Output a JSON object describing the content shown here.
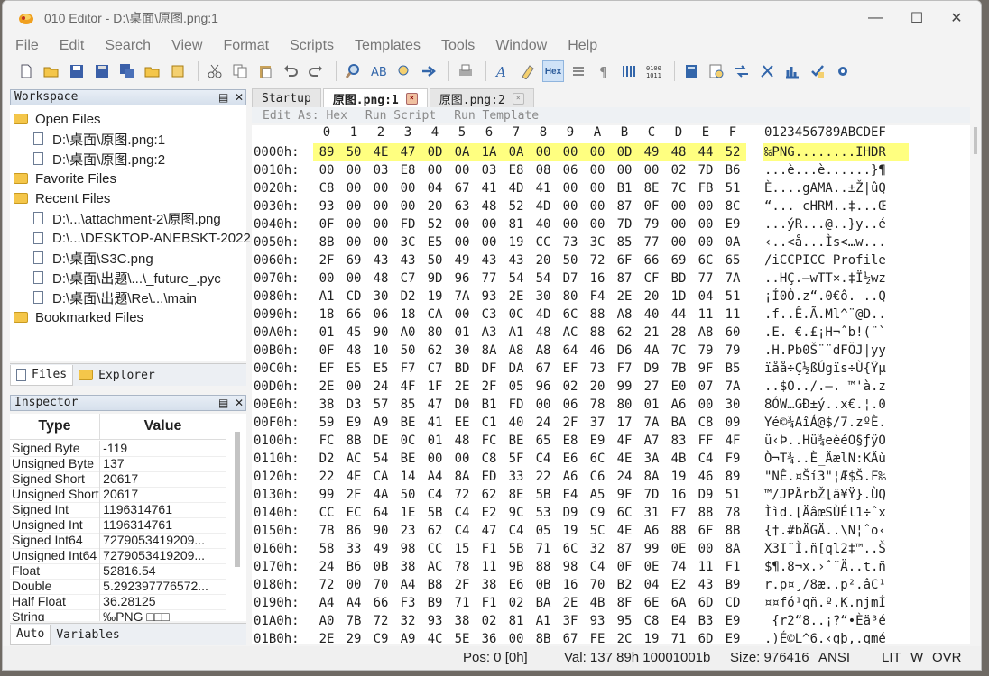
{
  "window": {
    "title": "010 Editor - D:\\桌面\\原图.png:1"
  },
  "menu": [
    "File",
    "Edit",
    "Search",
    "View",
    "Format",
    "Scripts",
    "Templates",
    "Tools",
    "Window",
    "Help"
  ],
  "toolbar_icons": [
    "new-file",
    "open-file",
    "save",
    "save-as",
    "save-all",
    "open-folder",
    "close",
    "cut",
    "copy",
    "paste",
    "undo",
    "redo",
    "find",
    "replace",
    "find-in-files",
    "goto",
    "print",
    "font",
    "highlight",
    "hex-mode",
    "bits",
    "paragraph",
    "columns",
    "binary",
    "calculator",
    "inspector",
    "compare",
    "tools",
    "histogram",
    "checksum",
    "options"
  ],
  "toolbar_hex_label": "Hex",
  "workspace": {
    "title": "Workspace",
    "open_files_label": "Open Files",
    "open_files": [
      "D:\\桌面\\原图.png:1",
      "D:\\桌面\\原图.png:2"
    ],
    "favorite_label": "Favorite Files",
    "recent_label": "Recent Files",
    "recent_files": [
      "D:\\...\\attachment-2\\原图.png",
      "D:\\...\\DESKTOP-ANEBSKT-2022",
      "D:\\桌面\\S3C.png",
      "D:\\桌面\\出题\\...\\_future_.pyc",
      "D:\\桌面\\出题\\Re\\...\\main"
    ],
    "bookmarked_label": "Bookmarked Files",
    "tabs": [
      "Files",
      "Explorer"
    ]
  },
  "inspector": {
    "title": "Inspector",
    "col_type": "Type",
    "col_value": "Value",
    "rows": [
      {
        "type": "Signed Byte",
        "value": "-119"
      },
      {
        "type": "Unsigned Byte",
        "value": "137"
      },
      {
        "type": "Signed Short",
        "value": "20617"
      },
      {
        "type": "Unsigned Short",
        "value": "20617"
      },
      {
        "type": "Signed Int",
        "value": "1196314761"
      },
      {
        "type": "Unsigned Int",
        "value": "1196314761"
      },
      {
        "type": "Signed Int64",
        "value": "7279053419209..."
      },
      {
        "type": "Unsigned Int64",
        "value": "7279053419209..."
      },
      {
        "type": "Float",
        "value": "52816.54"
      },
      {
        "type": "Double",
        "value": "5.292397776572..."
      },
      {
        "type": "Half Float",
        "value": "36.28125"
      },
      {
        "type": "String",
        "value": "‰PNG □□□"
      }
    ],
    "tabs": [
      "Auto",
      "Variables"
    ]
  },
  "editor": {
    "tabs": [
      {
        "label": "Startup"
      },
      {
        "label": "原图.png:1",
        "active": true
      },
      {
        "label": "原图.png:2"
      }
    ],
    "toolbar": [
      "Edit As: Hex",
      "Run Script",
      "Run Template"
    ],
    "col_headers": [
      "0",
      "1",
      "2",
      "3",
      "4",
      "5",
      "6",
      "7",
      "8",
      "9",
      "A",
      "B",
      "C",
      "D",
      "E",
      "F"
    ],
    "ascii_header": "0123456789ABCDEF",
    "rows": [
      {
        "addr": "0000h:",
        "bytes": "89 50 4E 47 0D 0A 1A 0A 00 00 00 0D 49 48 44 52",
        "ascii": "‰PNG........IHDR"
      },
      {
        "addr": "0010h:",
        "bytes": "00 00 03 E8 00 00 03 E8 08 06 00 00 00 02 7D B6",
        "ascii": "...è...è......}¶"
      },
      {
        "addr": "0020h:",
        "bytes": "C8 00 00 00 04 67 41 4D 41 00 00 B1 8E 7C FB 51",
        "ascii": "È....gAMA..±Ž|ûQ"
      },
      {
        "addr": "0030h:",
        "bytes": "93 00 00 00 20 63 48 52 4D 00 00 87 0F 00 00 8C",
        "ascii": "“... cHRM..‡...Œ"
      },
      {
        "addr": "0040h:",
        "bytes": "0F 00 00 FD 52 00 00 81 40 00 00 7D 79 00 00 E9",
        "ascii": "...ýR...@..}y..é"
      },
      {
        "addr": "0050h:",
        "bytes": "8B 00 00 3C E5 00 00 19 CC 73 3C 85 77 00 00 0A",
        "ascii": "‹..<å...Ìs<…w..."
      },
      {
        "addr": "0060h:",
        "bytes": "2F 69 43 43 50 49 43 43 20 50 72 6F 66 69 6C 65",
        "ascii": "/iCCPICC Profile"
      },
      {
        "addr": "0070h:",
        "bytes": "00 00 48 C7 9D 96 77 54 54 D7 16 87 CF BD 77 7A",
        "ascii": "..HÇ.–wTT×.‡Ï½wz"
      },
      {
        "addr": "0080h:",
        "bytes": "A1 CD 30 D2 19 7A 93 2E 30 80 F4 2E 20 1D 04 51",
        "ascii": "¡Í0Ò.z“.0€ô. ..Q"
      },
      {
        "addr": "0090h:",
        "bytes": "18 66 06 18 CA 00 C3 0C 4D 6C 88 A8 40 44 11 11",
        "ascii": ".f..Ê.Ã.Ml^¨@D.."
      },
      {
        "addr": "00A0h:",
        "bytes": "01 45 90 A0 80 01 A3 A1 48 AC 88 62 21 28 A8 60",
        "ascii": ".E. €.£¡H¬ˆb!(¨`"
      },
      {
        "addr": "00B0h:",
        "bytes": "0F 48 10 50 62 30 8A A8 A8 64 46 D6 4A 7C 79 79",
        "ascii": ".H.Pb0Š¨¨dFÖJ|yy"
      },
      {
        "addr": "00C0h:",
        "bytes": "EF E5 E5 F7 C7 BD DF DA 67 EF 73 F7 D9 7B 9F B5",
        "ascii": "ïåå÷Ç½ßÚgïs÷Ù{Ÿµ"
      },
      {
        "addr": "00D0h:",
        "bytes": "2E 00 24 4F 1F 2E 2F 05 96 02 20 99 27 E0 07 7A",
        "ascii": "..$O../.–. ™'à.z"
      },
      {
        "addr": "00E0h:",
        "bytes": "38 D3 57 85 47 D0 B1 FD 00 06 78 80 01 A6 00 30",
        "ascii": "8ÓW…GÐ±ý..x€.¦.0"
      },
      {
        "addr": "00F0h:",
        "bytes": "59 E9 A9 BE 41 EE C1 40 24 2F 37 17 7A BA C8 09",
        "ascii": "Yé©¾AîÁ@$/7.zºÈ."
      },
      {
        "addr": "0100h:",
        "bytes": "FC 8B DE 0C 01 48 FC BE 65 E8 E9 4F A7 83 FF 4F",
        "ascii": "ü‹Þ..Hü¾eèéO§ƒÿO"
      },
      {
        "addr": "0110h:",
        "bytes": "D2 AC 54 BE 00 00 C8 5F C4 E6 6C 4E 3A 4B C4 F9",
        "ascii": "Ò¬T¾..È_ÄælN:KÄù"
      },
      {
        "addr": "0120h:",
        "bytes": "22 4E CA 14 A4 8A ED 33 22 A6 C6 24 8A 19 46 89",
        "ascii": "\"NÊ.¤Ší3\"¦Æ$Š.F‰"
      },
      {
        "addr": "0130h:",
        "bytes": "99 2F 4A 50 C4 72 62 8E 5B E4 A5 9F 7D 16 D9 51",
        "ascii": "™/JPÄrbŽ[ä¥Ÿ}.ÙQ"
      },
      {
        "addr": "0140h:",
        "bytes": "CC EC 64 1E 5B C4 E2 9C 53 D9 C9 6C 31 F7 88 78",
        "ascii": "Ììd.[ÄâœSÙÉl1÷ˆx"
      },
      {
        "addr": "0150h:",
        "bytes": "7B 86 90 23 62 C4 47 C4 05 19 5C 4E A6 88 6F 8B",
        "ascii": "{†.#bÄGÄ..\\N¦ˆo‹"
      },
      {
        "addr": "0160h:",
        "bytes": "58 33 49 98 CC 15 F1 5B 71 6C 32 87 99 0E 00 8A",
        "ascii": "X3I˜Ì.ñ[ql2‡™..Š"
      },
      {
        "addr": "0170h:",
        "bytes": "24 B6 0B 38 AC 78 11 9B 88 98 C4 0F 0E 74 11 F1",
        "ascii": "$¶.8¬x.›ˆ˜Ä..t.ñ"
      },
      {
        "addr": "0180h:",
        "bytes": "72 00 70 A4 B8 2F 38 E6 0B 16 70 B2 04 E2 43 B9",
        "ascii": "r.p¤¸/8æ..p².âC¹"
      },
      {
        "addr": "0190h:",
        "bytes": "A4 A4 66 F3 B9 71 F1 02 BA 2E 4B 8F 6E 6A 6D CD",
        "ascii": "¤¤fó¹qñ.º.K.njmÍ"
      },
      {
        "addr": "01A0h:",
        "bytes": "A0 7B 72 32 93 38 02 81 A1 3F 93 95 C8 E4 B3 E9",
        "ascii": " {r2“8..¡?“•Èä³é"
      },
      {
        "addr": "01B0h:",
        "bytes": "2E 29 C9 A9 4C 5E 36 00 8B 67 FE 2C 19 71 6D E9",
        "ascii": ".)É©L^6.‹gþ,.qmé"
      }
    ]
  },
  "status": {
    "pos": "Pos: 0 [0h]",
    "val": "Val: 137 89h 10001001b",
    "size": "Size: 976416",
    "enc": "ANSI",
    "lit": "LIT",
    "w": "W",
    "ovr": "OVR"
  }
}
